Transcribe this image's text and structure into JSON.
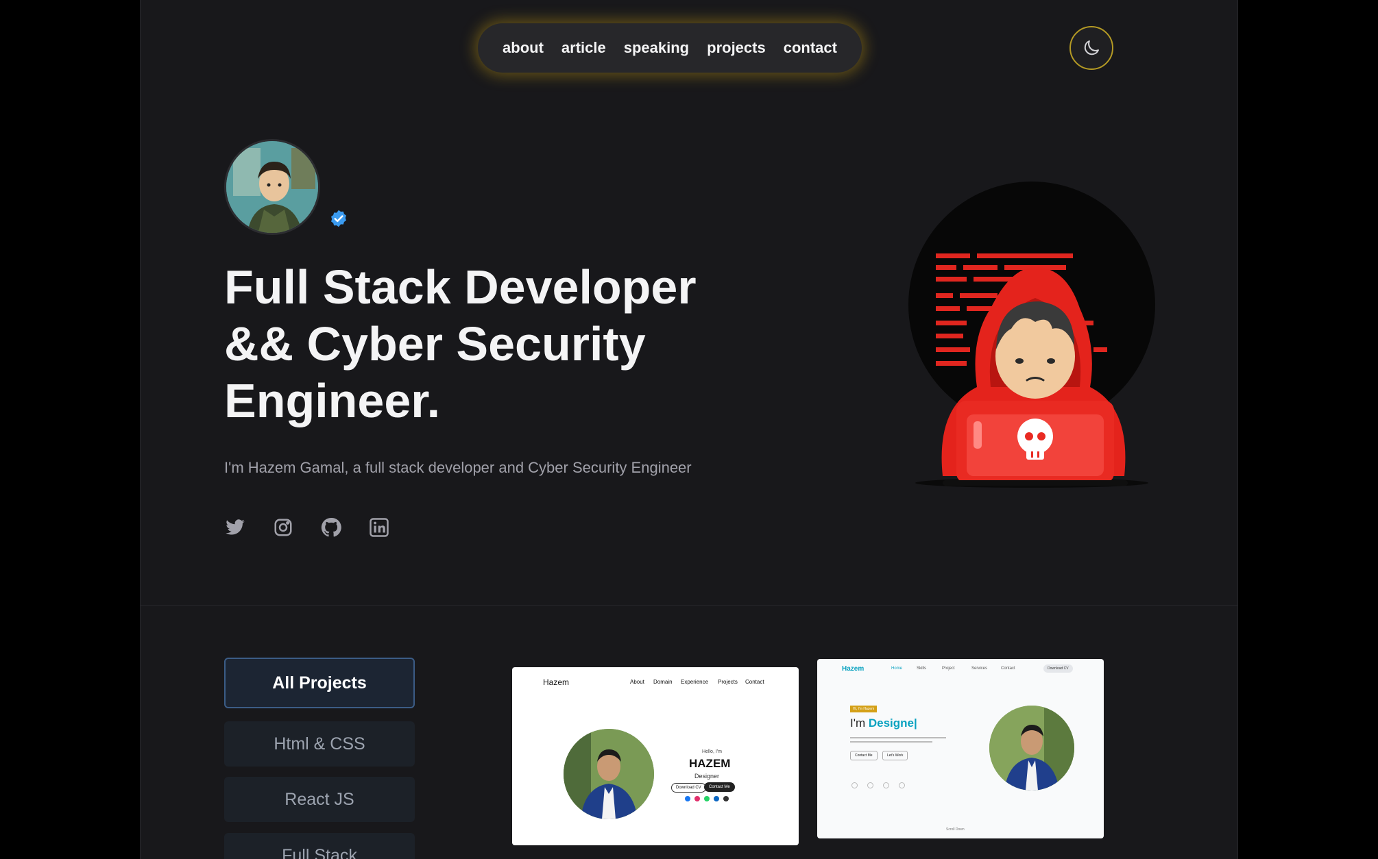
{
  "nav": {
    "links": [
      "about",
      "article",
      "speaking",
      "projects",
      "contact"
    ]
  },
  "icons": {
    "theme": "moon-icon",
    "verified": "verified-badge-icon",
    "socials": [
      "twitter-icon",
      "instagram-icon",
      "github-icon",
      "linkedin-icon"
    ]
  },
  "hero": {
    "title_lines": [
      "Full Stack Developer",
      "&& Cyber Security",
      "Engineer."
    ],
    "subtitle": "I'm Hazem Gamal, a full stack developer and Cyber Security Engineer"
  },
  "filters": [
    "All Projects",
    "Html & CSS",
    "React JS",
    "Full Stack"
  ],
  "projects": {
    "card1": {
      "logo": "Hazem",
      "nav": [
        "About",
        "Domain",
        "Experience",
        "Projects",
        "Contact"
      ],
      "hello": "Hello, I'm",
      "name": "HAZEM",
      "role": "Designer",
      "btn1": "Download CV",
      "btn2": "Contact Me"
    },
    "card2": {
      "logo": "Hazem",
      "nav": [
        "Home",
        "Skills",
        "Project",
        "Services",
        "Contact"
      ],
      "btn": "Download CV",
      "tag": "Hi, I'm Hazem",
      "headline_prefix": "I'm ",
      "headline_accent": "Designe|",
      "btn1": "Contact Me",
      "btn2": "Let's Work",
      "scroll": "Scroll Down"
    }
  },
  "colors": {
    "accent_glow": "#caa014",
    "verified": "#3b9bf0",
    "filter_active_border": "#3b5c86",
    "illus_red": "#e0261f"
  }
}
